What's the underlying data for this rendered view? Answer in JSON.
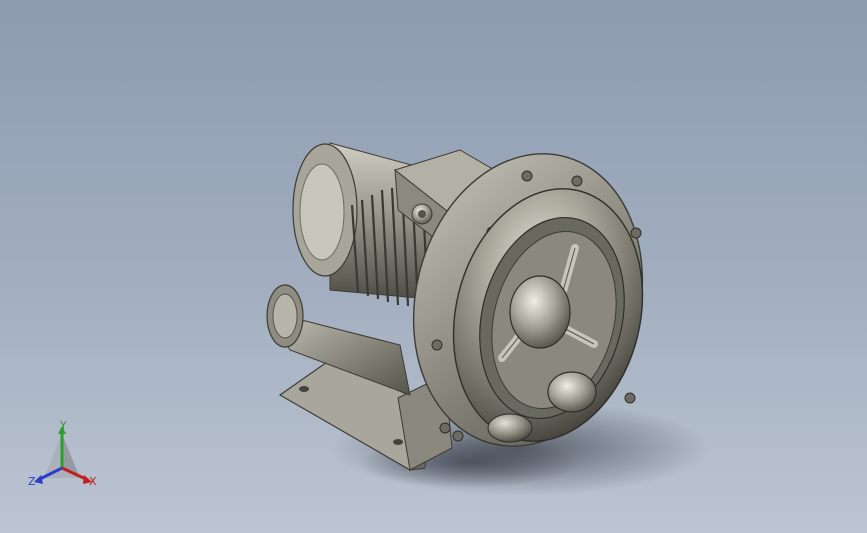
{
  "viewport": {
    "background_top": "#8d9bb0",
    "background_bottom": "#bcc5d2"
  },
  "model": {
    "icon": "regenerative-blower-3d-model",
    "metal_color": "#8e8c80",
    "shadow_color": "#4a4f5a"
  },
  "triad": {
    "labels": {
      "x": "X",
      "y": "Y",
      "z": "Z"
    },
    "colors": {
      "x": "#c02020",
      "y": "#2e9e2e",
      "z": "#2c3fc8"
    }
  }
}
